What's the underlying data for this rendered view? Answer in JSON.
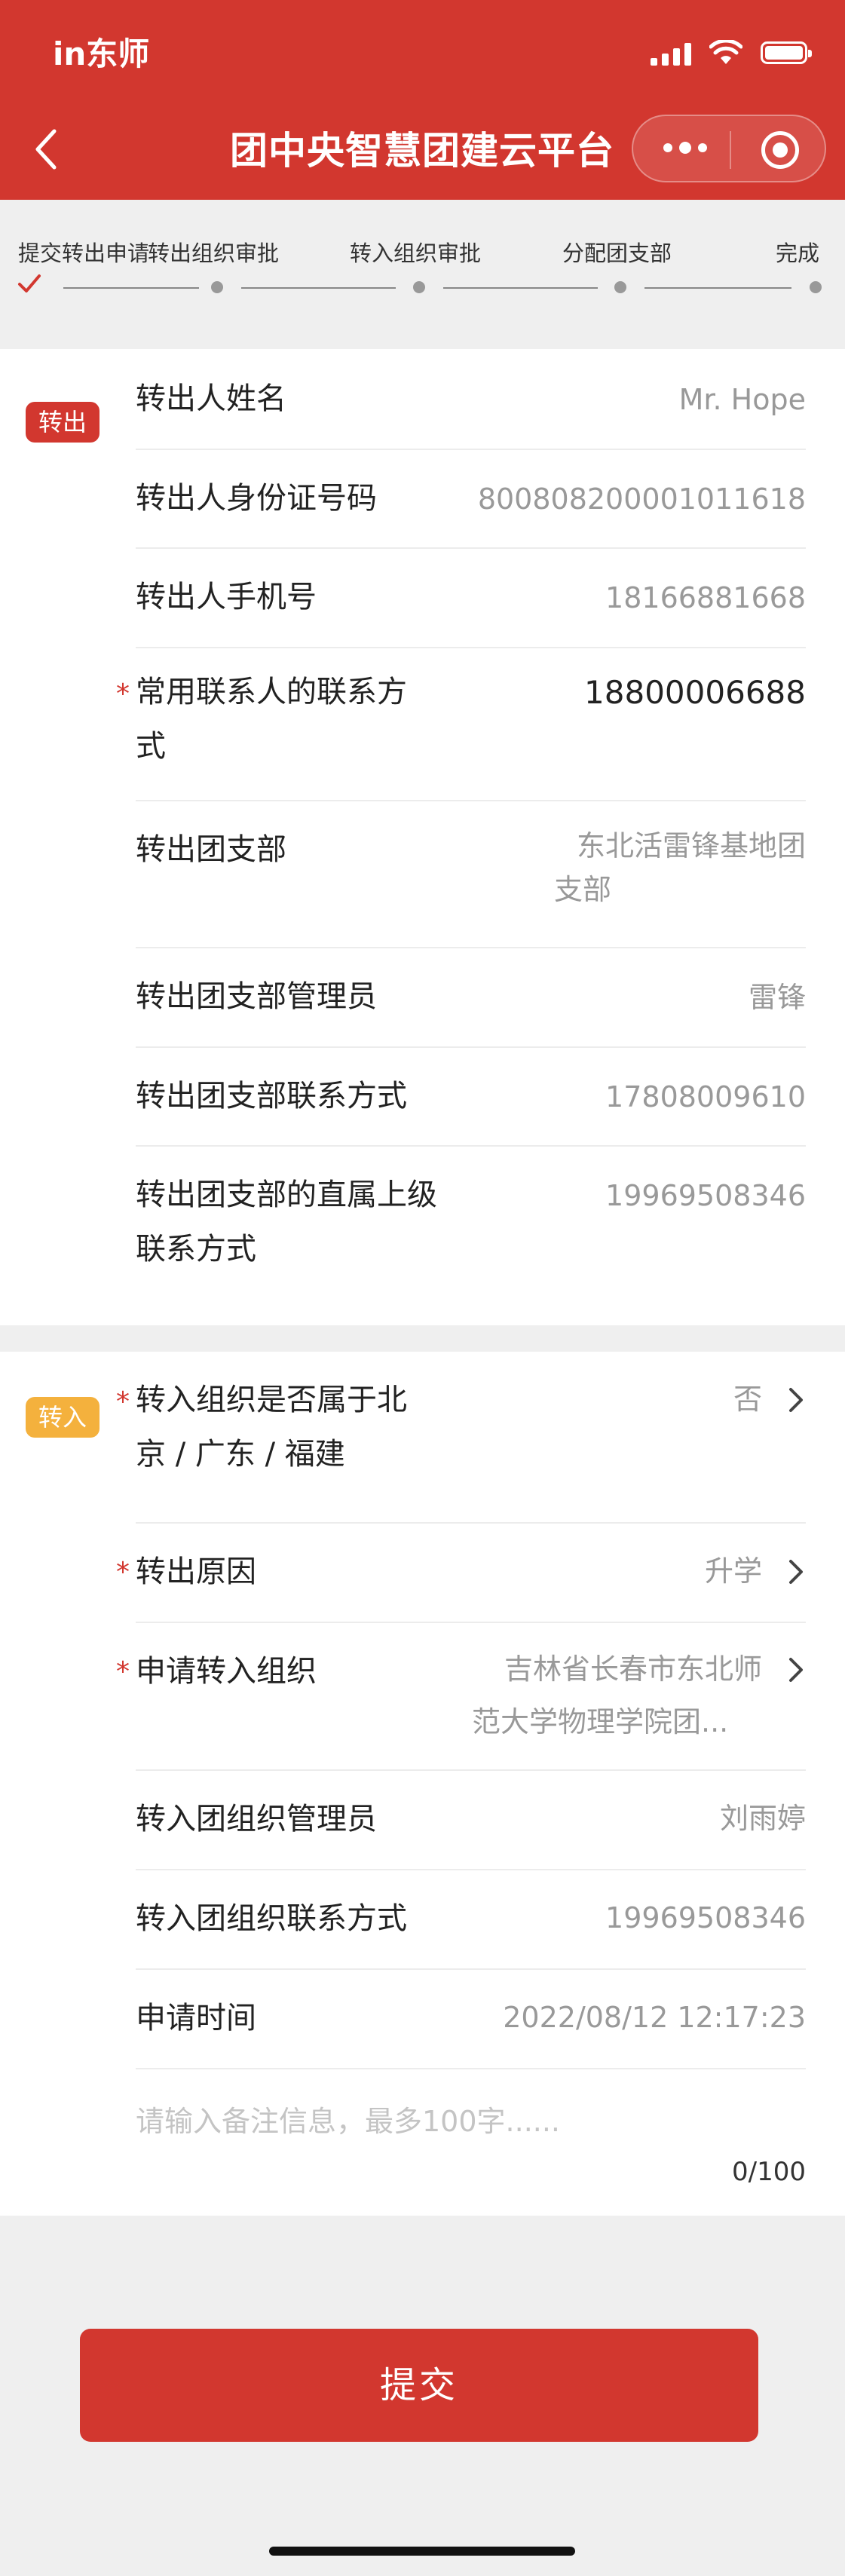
{
  "status_bar": {
    "carrier": "in东师"
  },
  "nav": {
    "title": "团中央智慧团建云平台"
  },
  "steps": [
    {
      "label": "提交转出申请"
    },
    {
      "label": "转出组织审批"
    },
    {
      "label": "转入组织审批"
    },
    {
      "label": "分配团支部"
    },
    {
      "label": "完成"
    }
  ],
  "out_section": {
    "tag": "转出",
    "rows": [
      {
        "label": "转出人姓名",
        "value": "Mr. Hope"
      },
      {
        "label": "转出人身份证号码",
        "value": "800808200001011618"
      },
      {
        "label": "转出人手机号",
        "value": "18166881668"
      },
      {
        "label_line1": "常用联系人的联系方",
        "label_line2": "式",
        "value": "18800006688",
        "required": true
      },
      {
        "label": "转出团支部",
        "value_line1": "东北活雷锋基地团",
        "value_line2": "支部"
      },
      {
        "label": "转出团支部管理员",
        "value": "雷锋"
      },
      {
        "label": "转出团支部联系方式",
        "value": "17808009610"
      },
      {
        "label_line1": "转出团支部的直属上级",
        "label_line2": "联系方式",
        "value": "19969508346"
      }
    ]
  },
  "in_section": {
    "tag": "转入",
    "rows": [
      {
        "label_line1": "转入组织是否属于北",
        "label_line2": "京 / 广东 / 福建",
        "value": "否",
        "required": true
      },
      {
        "label": "转出原因",
        "value": "升学",
        "required": true
      },
      {
        "label": "申请转入组织",
        "value_line1": "吉林省长春市东北师",
        "value_line2": "范大学物理学院团...",
        "required": true
      },
      {
        "label": "转入团组织管理员",
        "value": "刘雨婷"
      },
      {
        "label": "转入团组织联系方式",
        "value": "19969508346"
      },
      {
        "label": "申请时间",
        "value": "2022/08/12 12:17:23"
      }
    ],
    "remark": {
      "placeholder": "请输入备注信息，最多100字......",
      "counter": "0/100"
    }
  },
  "submit_label": "提交",
  "colors": {
    "primary": "#d2372f",
    "tag_in": "#f4b13d",
    "placeholder": "#c4c4c4",
    "value_gray": "#999999"
  },
  "icons": [
    "back-arrow-icon",
    "more-dots-icon",
    "target-circle-icon",
    "check-icon",
    "chevron-right-icon",
    "signal-icon",
    "wifi-icon",
    "battery-icon"
  ]
}
